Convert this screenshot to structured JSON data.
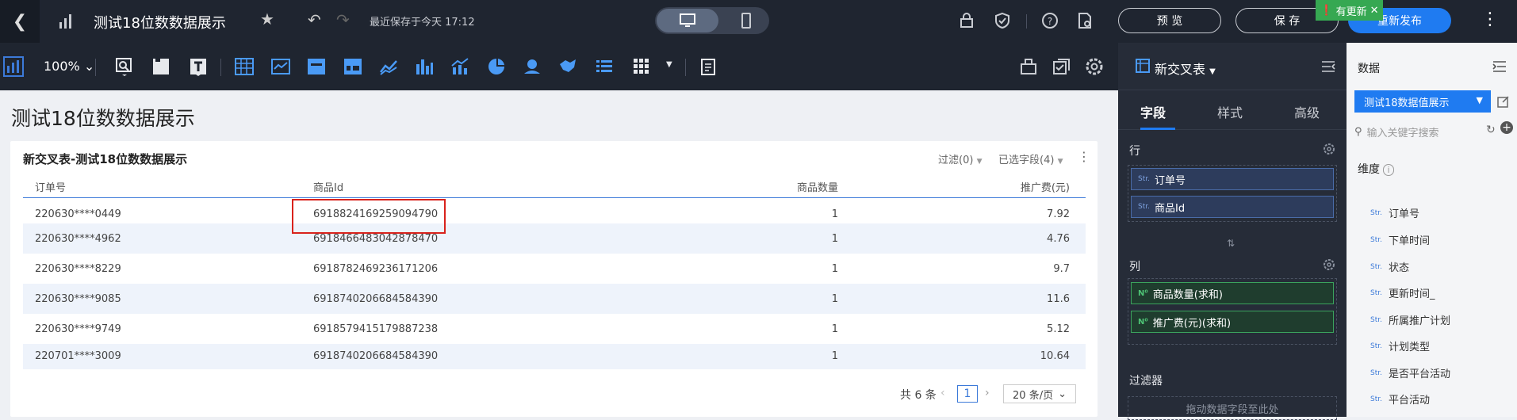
{
  "topbar": {
    "title": "测试18位数数据展示",
    "saved_text": "最近保存于今天 17:12",
    "preview_label": "预 览",
    "save_label": "保 存",
    "update_badge": "有更新",
    "republish_label": "重新发布"
  },
  "toolbar": {
    "zoom": "100%"
  },
  "canvas": {
    "page_title": "测试18位数数据展示"
  },
  "card": {
    "title": "新交叉表-测试18位数数据展示",
    "filter_label": "过滤(0)",
    "selected_fields_label": "已选字段(4)",
    "columns": [
      "订单号",
      "商品Id",
      "商品数量",
      "推广费(元)"
    ],
    "rows": [
      [
        "220630****0449",
        "6918824169259094790",
        "1",
        "7.92"
      ],
      [
        "220630****4962",
        "6918466483042878470",
        "1",
        "4.76"
      ],
      [
        "220630****8229",
        "6918782469236171206",
        "1",
        "9.7"
      ],
      [
        "220630****9085",
        "6918740206684584390",
        "1",
        "11.6"
      ],
      [
        "220630****9749",
        "6918579415179887238",
        "1",
        "5.12"
      ],
      [
        "220701****3009",
        "6918740206684584390",
        "1",
        "10.64"
      ]
    ],
    "pager": {
      "total": "共 6 条",
      "current_page": "1",
      "page_size": "20 条/页"
    }
  },
  "config_panel": {
    "chart_type": "新交叉表",
    "tabs": [
      "字段",
      "样式",
      "高级"
    ],
    "rows_label": "行",
    "row_fields": [
      "订单号",
      "商品Id"
    ],
    "cols_label": "列",
    "col_fields": [
      "商品数量(求和)",
      "推广费(元)(求和)"
    ],
    "filters_label": "过滤器",
    "drag_hint": "拖动数据字段至此处",
    "str_tag": "Str.",
    "num_tag": "N⁰"
  },
  "data_panel": {
    "header": "数据",
    "dataset": "测试18数据值展示",
    "search_placeholder": "输入关键字搜索",
    "dimension_label": "维度",
    "field_tag": "Str.",
    "fields": [
      "订单号",
      "下单时间",
      "状态",
      "更新时间_",
      "所属推广计划",
      "计划类型",
      "是否平台活动",
      "平台活动"
    ]
  },
  "colors": {
    "topbar_bg": "#1f2530",
    "accent": "#1f7bf1",
    "highlight_box": "#d9221c",
    "update_badge": "#36a852"
  }
}
